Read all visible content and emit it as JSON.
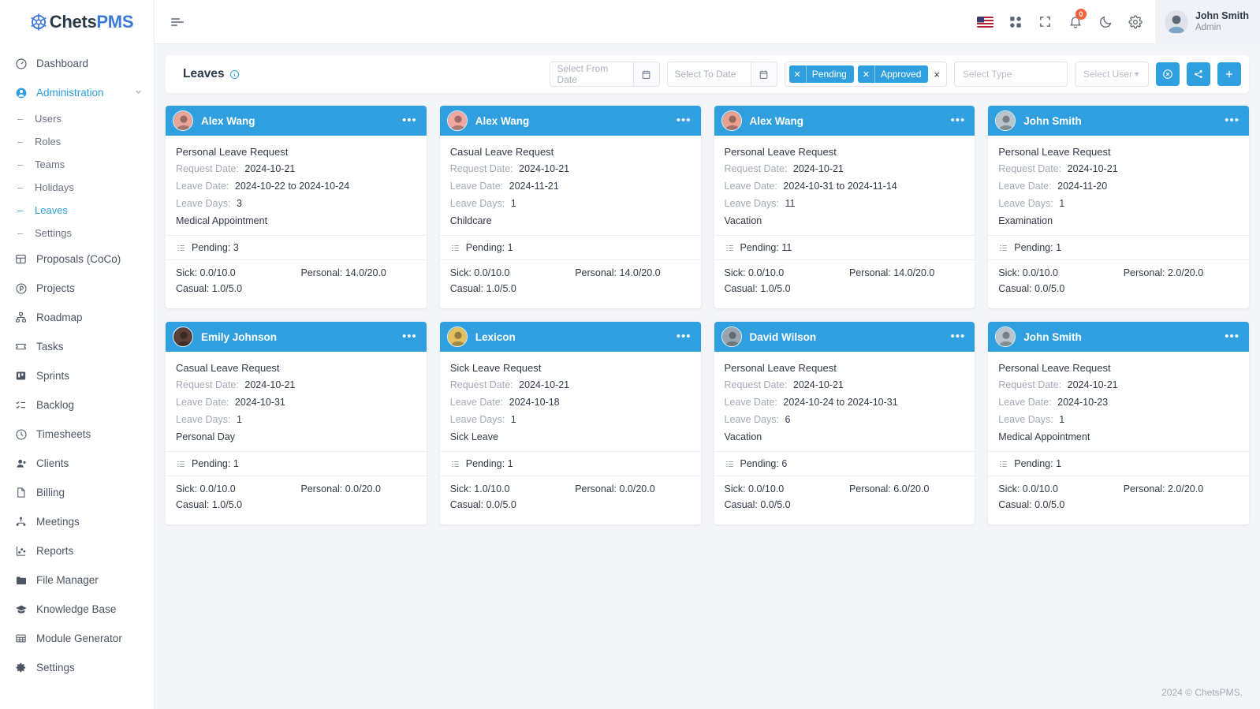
{
  "brand": {
    "name_prefix": "Chets",
    "name_suffix": "PMS",
    "accent": "#2f9fe0"
  },
  "sidebar": {
    "items": [
      {
        "label": "Dashboard",
        "icon": "speedometer-icon"
      },
      {
        "label": "Administration",
        "icon": "user-circle-icon"
      },
      {
        "label": "Proposals (CoCo)",
        "icon": "layout-icon"
      },
      {
        "label": "Projects",
        "icon": "circle-p-icon"
      },
      {
        "label": "Roadmap",
        "icon": "hierarchy-icon"
      },
      {
        "label": "Tasks",
        "icon": "ticket-icon"
      },
      {
        "label": "Sprints",
        "icon": "board-icon"
      },
      {
        "label": "Backlog",
        "icon": "list-check-icon"
      },
      {
        "label": "Timesheets",
        "icon": "clock-icon"
      },
      {
        "label": "Clients",
        "icon": "user-group-icon"
      },
      {
        "label": "Billing",
        "icon": "file-icon"
      },
      {
        "label": "Meetings",
        "icon": "people-network-icon"
      },
      {
        "label": "Reports",
        "icon": "chart-icon"
      },
      {
        "label": "File Manager",
        "icon": "folder-icon"
      },
      {
        "label": "Knowledge Base",
        "icon": "graduation-cap-icon"
      },
      {
        "label": "Module Generator",
        "icon": "table-icon"
      },
      {
        "label": "Settings",
        "icon": "gear-icon"
      }
    ],
    "admin_children": [
      {
        "label": "Users"
      },
      {
        "label": "Roles"
      },
      {
        "label": "Teams"
      },
      {
        "label": "Holidays"
      },
      {
        "label": "Leaves"
      },
      {
        "label": "Settings"
      }
    ]
  },
  "topbar": {
    "notification_count": "0",
    "user_name": "John Smith",
    "user_role": "Admin"
  },
  "toolbar": {
    "title": "Leaves",
    "from_date_placeholder": "Select From Date",
    "to_date_placeholder": "Select To Date",
    "status_tags": [
      {
        "label": "Pending"
      },
      {
        "label": "Approved"
      }
    ],
    "tag_clear": "×",
    "type_placeholder": "Select Type",
    "user_placeholder": "Select User"
  },
  "labels": {
    "request_date": "Request Date:",
    "leave_date": "Leave Date:",
    "leave_days": "Leave Days:"
  },
  "cards": [
    {
      "name": "Alex Wang",
      "avatar": "#e8a598",
      "leave_title": "Personal Leave Request",
      "request_date": "2024-10-21",
      "leave_date": "2024-10-22 to 2024-10-24",
      "leave_days": "3",
      "reason": "Medical Appointment",
      "status": "Pending: 3",
      "sick": "Sick: 0.0/10.0",
      "personal": "Personal: 14.0/20.0",
      "casual": "Casual: 1.0/5.0"
    },
    {
      "name": "Alex Wang",
      "avatar": "#f0a8a0",
      "leave_title": "Casual Leave Request",
      "request_date": "2024-10-21",
      "leave_date": "2024-11-21",
      "leave_days": "1",
      "reason": "Childcare",
      "status": "Pending: 1",
      "sick": "Sick: 0.0/10.0",
      "personal": "Personal: 14.0/20.0",
      "casual": "Casual: 1.0/5.0"
    },
    {
      "name": "Alex Wang",
      "avatar": "#e8a090",
      "leave_title": "Personal Leave Request",
      "request_date": "2024-10-21",
      "leave_date": "2024-10-31 to 2024-11-14",
      "leave_days": "11",
      "reason": "Vacation",
      "status": "Pending: 11",
      "sick": "Sick: 0.0/10.0",
      "personal": "Personal: 14.0/20.0",
      "casual": "Casual: 1.0/5.0"
    },
    {
      "name": "John Smith",
      "avatar": "#b9c4cc",
      "leave_title": "Personal Leave Request",
      "request_date": "2024-10-21",
      "leave_date": "2024-11-20",
      "leave_days": "1",
      "reason": "Examination",
      "status": "Pending: 1",
      "sick": "Sick: 0.0/10.0",
      "personal": "Personal: 2.0/20.0",
      "casual": "Casual: 0.0/5.0"
    },
    {
      "name": "Emily Johnson",
      "avatar": "#5a4036",
      "leave_title": "Casual Leave Request",
      "request_date": "2024-10-21",
      "leave_date": "2024-10-31",
      "leave_days": "1",
      "reason": "Personal Day",
      "status": "Pending: 1",
      "sick": "Sick: 0.0/10.0",
      "personal": "Personal: 0.0/20.0",
      "casual": "Casual: 1.0/5.0"
    },
    {
      "name": "Lexicon",
      "avatar": "#e0c060",
      "leave_title": "Sick Leave Request",
      "request_date": "2024-10-21",
      "leave_date": "2024-10-18",
      "leave_days": "1",
      "reason": "Sick Leave",
      "status": "Pending: 1",
      "sick": "Sick: 1.0/10.0",
      "personal": "Personal: 0.0/20.0",
      "casual": "Casual: 0.0/5.0"
    },
    {
      "name": "David Wilson",
      "avatar": "#9aa4ae",
      "leave_title": "Personal Leave Request",
      "request_date": "2024-10-21",
      "leave_date": "2024-10-24 to 2024-10-31",
      "leave_days": "6",
      "reason": "Vacation",
      "status": "Pending: 6",
      "sick": "Sick: 0.0/10.0",
      "personal": "Personal: 6.0/20.0",
      "casual": "Casual: 0.0/5.0"
    },
    {
      "name": "John Smith",
      "avatar": "#b9c4cc",
      "leave_title": "Personal Leave Request",
      "request_date": "2024-10-21",
      "leave_date": "2024-10-23",
      "leave_days": "1",
      "reason": "Medical Appointment",
      "status": "Pending: 1",
      "sick": "Sick: 0.0/10.0",
      "personal": "Personal: 2.0/20.0",
      "casual": "Casual: 0.0/5.0"
    }
  ],
  "footer": {
    "text": "2024 © ChetsPMS."
  }
}
